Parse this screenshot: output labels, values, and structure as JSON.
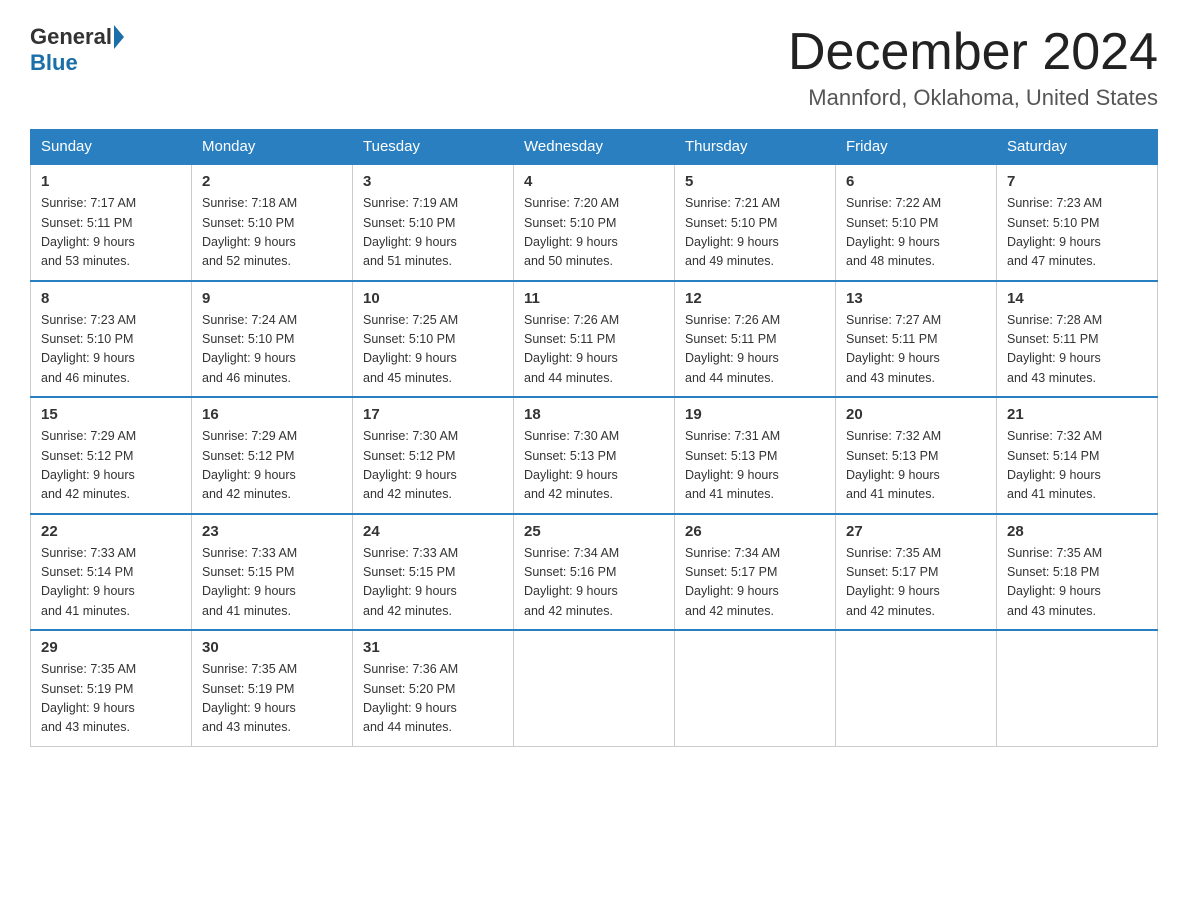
{
  "logo": {
    "general": "General",
    "blue": "Blue"
  },
  "header": {
    "month": "December 2024",
    "location": "Mannford, Oklahoma, United States"
  },
  "weekdays": [
    "Sunday",
    "Monday",
    "Tuesday",
    "Wednesday",
    "Thursday",
    "Friday",
    "Saturday"
  ],
  "weeks": [
    [
      {
        "day": "1",
        "sunrise": "7:17 AM",
        "sunset": "5:11 PM",
        "daylight": "9 hours and 53 minutes."
      },
      {
        "day": "2",
        "sunrise": "7:18 AM",
        "sunset": "5:10 PM",
        "daylight": "9 hours and 52 minutes."
      },
      {
        "day": "3",
        "sunrise": "7:19 AM",
        "sunset": "5:10 PM",
        "daylight": "9 hours and 51 minutes."
      },
      {
        "day": "4",
        "sunrise": "7:20 AM",
        "sunset": "5:10 PM",
        "daylight": "9 hours and 50 minutes."
      },
      {
        "day": "5",
        "sunrise": "7:21 AM",
        "sunset": "5:10 PM",
        "daylight": "9 hours and 49 minutes."
      },
      {
        "day": "6",
        "sunrise": "7:22 AM",
        "sunset": "5:10 PM",
        "daylight": "9 hours and 48 minutes."
      },
      {
        "day": "7",
        "sunrise": "7:23 AM",
        "sunset": "5:10 PM",
        "daylight": "9 hours and 47 minutes."
      }
    ],
    [
      {
        "day": "8",
        "sunrise": "7:23 AM",
        "sunset": "5:10 PM",
        "daylight": "9 hours and 46 minutes."
      },
      {
        "day": "9",
        "sunrise": "7:24 AM",
        "sunset": "5:10 PM",
        "daylight": "9 hours and 46 minutes."
      },
      {
        "day": "10",
        "sunrise": "7:25 AM",
        "sunset": "5:10 PM",
        "daylight": "9 hours and 45 minutes."
      },
      {
        "day": "11",
        "sunrise": "7:26 AM",
        "sunset": "5:11 PM",
        "daylight": "9 hours and 44 minutes."
      },
      {
        "day": "12",
        "sunrise": "7:26 AM",
        "sunset": "5:11 PM",
        "daylight": "9 hours and 44 minutes."
      },
      {
        "day": "13",
        "sunrise": "7:27 AM",
        "sunset": "5:11 PM",
        "daylight": "9 hours and 43 minutes."
      },
      {
        "day": "14",
        "sunrise": "7:28 AM",
        "sunset": "5:11 PM",
        "daylight": "9 hours and 43 minutes."
      }
    ],
    [
      {
        "day": "15",
        "sunrise": "7:29 AM",
        "sunset": "5:12 PM",
        "daylight": "9 hours and 42 minutes."
      },
      {
        "day": "16",
        "sunrise": "7:29 AM",
        "sunset": "5:12 PM",
        "daylight": "9 hours and 42 minutes."
      },
      {
        "day": "17",
        "sunrise": "7:30 AM",
        "sunset": "5:12 PM",
        "daylight": "9 hours and 42 minutes."
      },
      {
        "day": "18",
        "sunrise": "7:30 AM",
        "sunset": "5:13 PM",
        "daylight": "9 hours and 42 minutes."
      },
      {
        "day": "19",
        "sunrise": "7:31 AM",
        "sunset": "5:13 PM",
        "daylight": "9 hours and 41 minutes."
      },
      {
        "day": "20",
        "sunrise": "7:32 AM",
        "sunset": "5:13 PM",
        "daylight": "9 hours and 41 minutes."
      },
      {
        "day": "21",
        "sunrise": "7:32 AM",
        "sunset": "5:14 PM",
        "daylight": "9 hours and 41 minutes."
      }
    ],
    [
      {
        "day": "22",
        "sunrise": "7:33 AM",
        "sunset": "5:14 PM",
        "daylight": "9 hours and 41 minutes."
      },
      {
        "day": "23",
        "sunrise": "7:33 AM",
        "sunset": "5:15 PM",
        "daylight": "9 hours and 41 minutes."
      },
      {
        "day": "24",
        "sunrise": "7:33 AM",
        "sunset": "5:15 PM",
        "daylight": "9 hours and 42 minutes."
      },
      {
        "day": "25",
        "sunrise": "7:34 AM",
        "sunset": "5:16 PM",
        "daylight": "9 hours and 42 minutes."
      },
      {
        "day": "26",
        "sunrise": "7:34 AM",
        "sunset": "5:17 PM",
        "daylight": "9 hours and 42 minutes."
      },
      {
        "day": "27",
        "sunrise": "7:35 AM",
        "sunset": "5:17 PM",
        "daylight": "9 hours and 42 minutes."
      },
      {
        "day": "28",
        "sunrise": "7:35 AM",
        "sunset": "5:18 PM",
        "daylight": "9 hours and 43 minutes."
      }
    ],
    [
      {
        "day": "29",
        "sunrise": "7:35 AM",
        "sunset": "5:19 PM",
        "daylight": "9 hours and 43 minutes."
      },
      {
        "day": "30",
        "sunrise": "7:35 AM",
        "sunset": "5:19 PM",
        "daylight": "9 hours and 43 minutes."
      },
      {
        "day": "31",
        "sunrise": "7:36 AM",
        "sunset": "5:20 PM",
        "daylight": "9 hours and 44 minutes."
      },
      null,
      null,
      null,
      null
    ]
  ]
}
